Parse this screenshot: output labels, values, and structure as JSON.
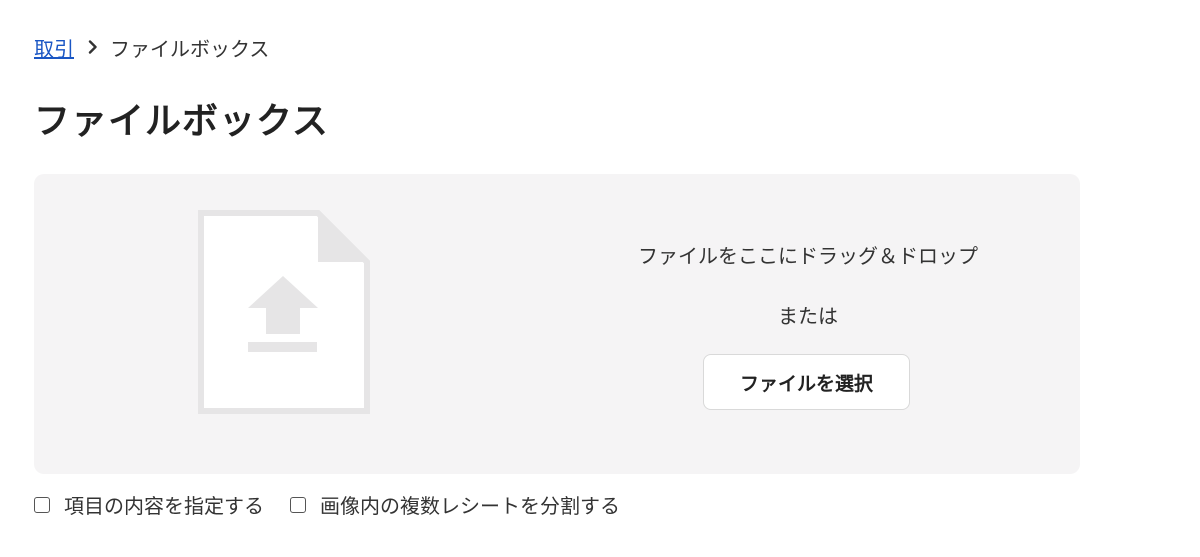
{
  "breadcrumb": {
    "parent_label": "取引",
    "current_label": "ファイルボックス",
    "separator_icon": "chevron-right-icon"
  },
  "page": {
    "title": "ファイルボックス"
  },
  "dropzone": {
    "illustration_icon": "file-upload-icon",
    "instruction": "ファイルをここにドラッグ＆ドロップ",
    "or_text": "または",
    "select_button_label": "ファイルを選択"
  },
  "options": [
    {
      "label": "項目の内容を指定する",
      "checked": false
    },
    {
      "label": "画像内の複数レシートを分割する",
      "checked": false
    }
  ],
  "colors": {
    "link": "#1a56c4",
    "dropzone_bg": "#f5f4f5",
    "illustration": "#e6e5e6"
  }
}
